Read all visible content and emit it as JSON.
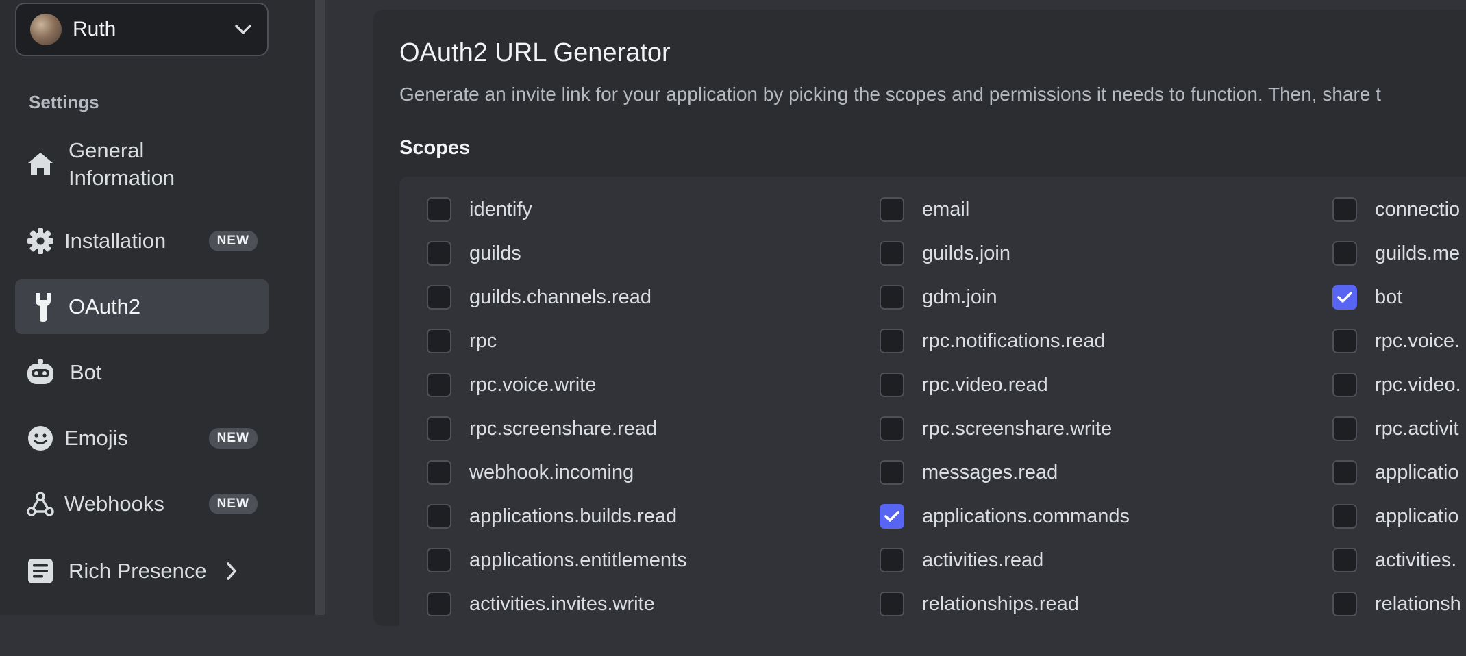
{
  "user": {
    "name": "Ruth"
  },
  "sidebar": {
    "section_title": "Settings",
    "items": [
      {
        "label": "General\nInformation",
        "icon": "home-icon"
      },
      {
        "label": "Installation",
        "icon": "gear-icon",
        "badge": "NEW"
      },
      {
        "label": "OAuth2",
        "icon": "wrench-icon",
        "active": true
      },
      {
        "label": "Bot",
        "icon": "bot-icon"
      },
      {
        "label": "Emojis",
        "icon": "smile-icon",
        "badge": "NEW"
      },
      {
        "label": "Webhooks",
        "icon": "webhook-icon",
        "badge": "NEW"
      },
      {
        "label": "Rich Presence",
        "icon": "document-icon"
      }
    ]
  },
  "main": {
    "title": "OAuth2 URL Generator",
    "description": "Generate an invite link for your application by picking the scopes and permissions it needs to function. Then, share t",
    "scopes_title": "Scopes",
    "scopes": [
      [
        "identify",
        "email",
        "connectio"
      ],
      [
        "guilds",
        "guilds.join",
        "guilds.me"
      ],
      [
        "guilds.channels.read",
        "gdm.join",
        "bot"
      ],
      [
        "rpc",
        "rpc.notifications.read",
        "rpc.voice."
      ],
      [
        "rpc.voice.write",
        "rpc.video.read",
        "rpc.video."
      ],
      [
        "rpc.screenshare.read",
        "rpc.screenshare.write",
        "rpc.activit"
      ],
      [
        "webhook.incoming",
        "messages.read",
        "applicatio"
      ],
      [
        "applications.builds.read",
        "applications.commands",
        "applicatio"
      ],
      [
        "applications.entitlements",
        "activities.read",
        "activities."
      ],
      [
        "activities.invites.write",
        "relationships.read",
        "relationsh"
      ]
    ],
    "checked": [
      "bot",
      "applications.commands"
    ]
  },
  "colors": {
    "accent": "#5865f2",
    "sidebar_bg": "#2b2d31",
    "panel_bg": "#313338"
  }
}
